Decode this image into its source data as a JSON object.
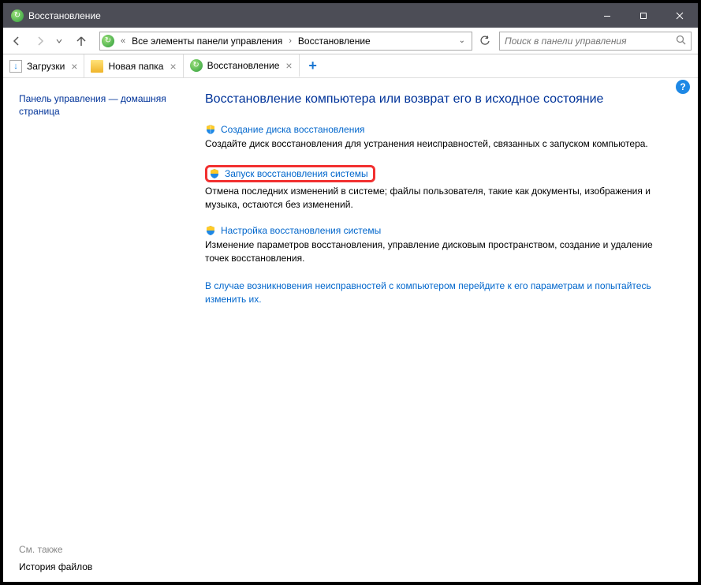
{
  "titlebar": {
    "title": "Восстановление"
  },
  "toolbar": {
    "breadcrumb": {
      "seg1": "Все элементы панели управления",
      "seg2": "Восстановление"
    },
    "search_placeholder": "Поиск в панели управления"
  },
  "tabs": [
    {
      "label": "Загрузки"
    },
    {
      "label": "Новая папка"
    },
    {
      "label": "Восстановление"
    }
  ],
  "sidebar": {
    "home_link": "Панель управления — домашняя страница",
    "see_also": "См. также",
    "history": "История файлов"
  },
  "main": {
    "heading": "Восстановление компьютера или возврат его в исходное состояние",
    "items": [
      {
        "title": "Создание диска восстановления",
        "desc": "Создайте диск восстановления для устранения неисправностей, связанных с запуском компьютера."
      },
      {
        "title": "Запуск восстановления системы",
        "desc": "Отмена последних изменений в системе; файлы пользователя, такие как документы, изображения и музыка, остаются без изменений."
      },
      {
        "title": "Настройка восстановления системы",
        "desc": "Изменение параметров восстановления, управление дисковым пространством, создание и удаление точек восстановления."
      }
    ],
    "footer_link": "В случае возникновения неисправностей с компьютером перейдите к его параметрам и попытайтесь изменить их."
  }
}
